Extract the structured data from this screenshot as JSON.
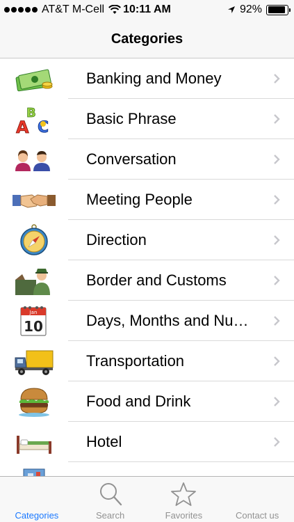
{
  "status_bar": {
    "carrier": "AT&T M-Cell",
    "time": "10:11 AM",
    "battery": "92%",
    "battery_level": 0.92
  },
  "nav": {
    "title": "Categories"
  },
  "categories": [
    {
      "label": "Banking and Money",
      "icon": "money-icon"
    },
    {
      "label": "Basic Phrase",
      "icon": "abc-icon"
    },
    {
      "label": "Conversation",
      "icon": "people-icon"
    },
    {
      "label": "Meeting People",
      "icon": "handshake-icon"
    },
    {
      "label": "Direction",
      "icon": "compass-icon"
    },
    {
      "label": "Border and Customs",
      "icon": "customs-officer-icon"
    },
    {
      "label": "Days, Months and Numbers",
      "icon": "calendar-icon",
      "calendar_month": "Jan",
      "calendar_day": "10"
    },
    {
      "label": "Transportation",
      "icon": "truck-icon"
    },
    {
      "label": "Food and Drink",
      "icon": "burger-icon"
    },
    {
      "label": "Hotel",
      "icon": "bed-icon"
    },
    {
      "label": "",
      "icon": "shopping-icon"
    }
  ],
  "tabs": [
    {
      "label": "Categories",
      "icon": "categories-icon",
      "active": true
    },
    {
      "label": "Search",
      "icon": "search-icon",
      "active": false
    },
    {
      "label": "Favorites",
      "icon": "star-icon",
      "active": false
    },
    {
      "label": "Contact us",
      "icon": "contact-icon",
      "active": false
    }
  ],
  "colors": {
    "accent": "#1a78ff",
    "inactive": "#929292",
    "separator": "#d9d9d9"
  }
}
